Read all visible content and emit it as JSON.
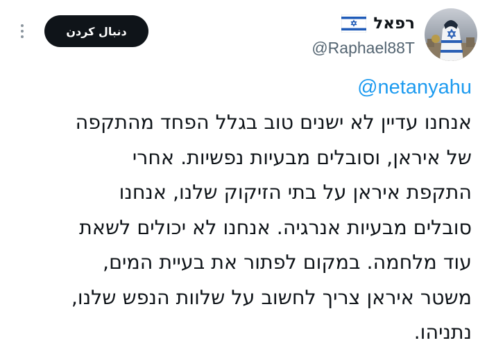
{
  "header": {
    "display_name": "רפאל",
    "handle": "@Raphael88T",
    "follow_label": "دنبال کردن",
    "flag_icon": "israel-flag-icon",
    "more_icon": "more-vertical-icon",
    "avatar_icon": "star-of-david-avatar-icon"
  },
  "tweet": {
    "mention": "@netanyahu",
    "lines": [
      "אנחנו עדיין לא ישנים טוב בגלל הפחד מהתקפה",
      "של איראן, וסובלים מבעיות נפשיות. אחרי",
      "התקפת איראן על בתי הזיקוק שלנו, אנחנו",
      "סובלים מבעיות אנרגיה. אנחנו לא יכולים לשאת",
      "עוד מלחמה. במקום לפתור את בעיית המים,",
      "משטר איראן צריך לחשוב על שלוות הנפש שלנו,",
      "נתניהו."
    ]
  },
  "colors": {
    "text": "#0f1419",
    "secondary": "#536471",
    "link": "#1d9bf0",
    "button_bg": "#0f1419",
    "button_text": "#ffffff"
  }
}
